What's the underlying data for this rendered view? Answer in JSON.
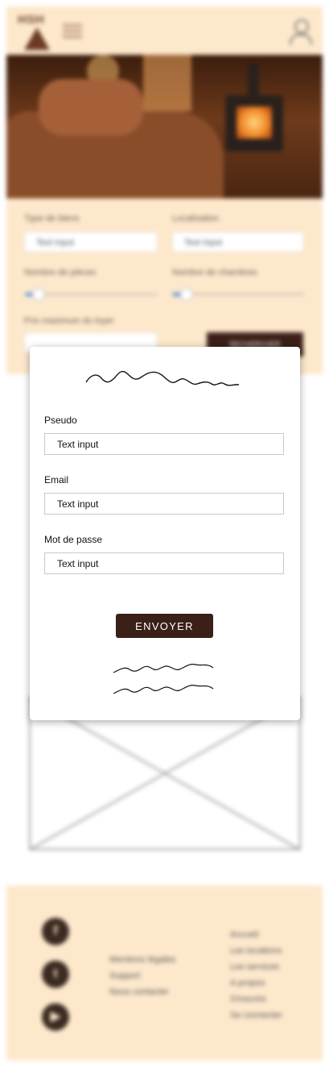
{
  "background_page": {
    "header": {
      "logo_text": "HSH",
      "menu_icon": "hamburger-menu-icon",
      "account_icon": "user-icon"
    },
    "search_form": {
      "property_type_label": "Type de biens",
      "property_type_placeholder": "Text input",
      "location_label": "Localisation",
      "location_placeholder": "Text input",
      "rooms_label": "Nombre de pièces",
      "bedrooms_label": "Nombre de chambres",
      "max_price_label": "Prix maximum du loyer",
      "submit_label": "RECHERCHER"
    },
    "footer": {
      "social_icons": [
        "facebook-icon",
        "twitter-icon",
        "youtube-icon"
      ],
      "legal_links": [
        "Mentions légales",
        "Support",
        "Nous contacter"
      ],
      "nav_links": [
        "Accueil",
        "Les locations",
        "Les services",
        "A propos",
        "S'inscrire",
        "Se connecter"
      ]
    }
  },
  "signup_modal": {
    "fields": [
      {
        "label": "Pseudo",
        "value": "Text input"
      },
      {
        "label": "Email",
        "value": "Text input"
      },
      {
        "label": "Mot de passe",
        "value": "Text input"
      }
    ],
    "submit_label": "ENVOYER"
  },
  "colors": {
    "beige": "#fde8cc",
    "brown_button": "#3b2018",
    "slider_accent": "#4a8ee0"
  }
}
